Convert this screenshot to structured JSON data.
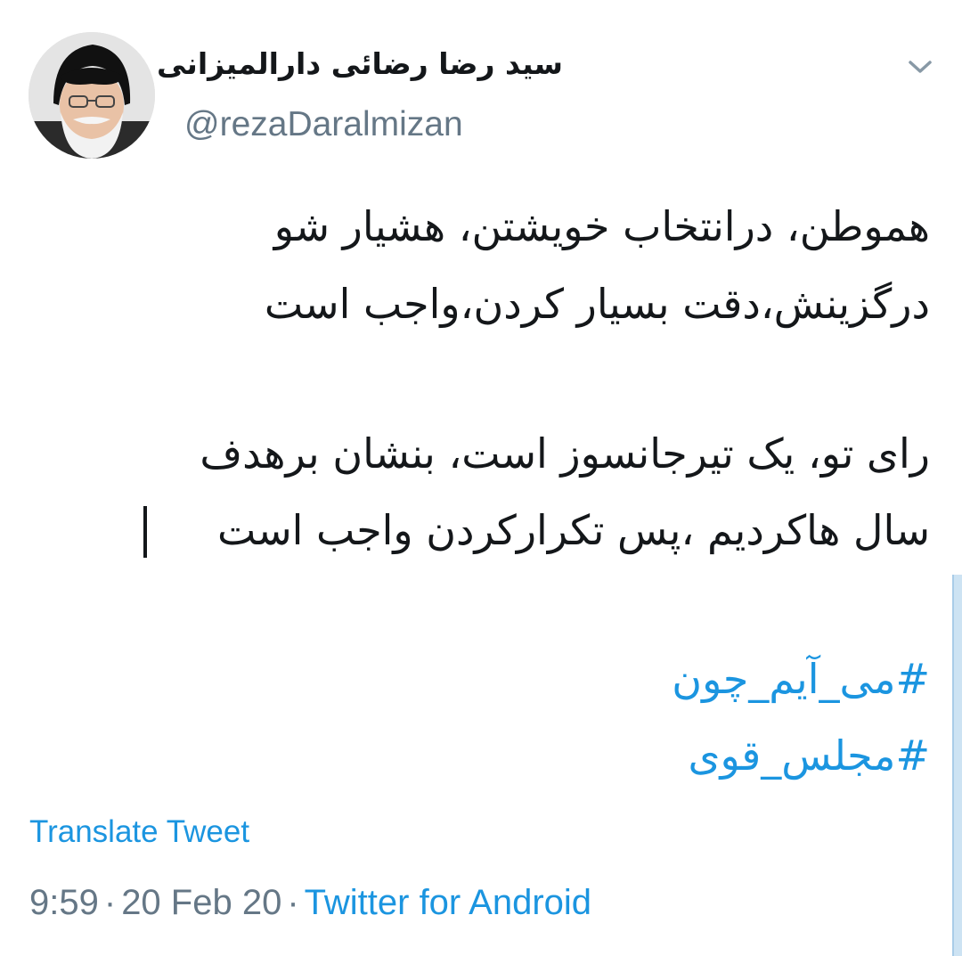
{
  "author": {
    "display_name": "سید رضا رضائی دارالمیزانی",
    "handle": "@rezaDaralmizan",
    "avatar_icon": "profile-photo"
  },
  "tweet": {
    "lines": [
      "هموطن، درانتخاب خویشتن، هشیار شو",
      "درگزینش،دقت بسیار کردن،واجب است",
      "رای تو، یک تیرجانسوز است، بنشان برهدف",
      "سال هاکردیم ،پس تکرارکردن واجب است"
    ],
    "hashtags": [
      "#می_آیم_چون",
      "#مجلس_قوی"
    ]
  },
  "actions": {
    "translate_label": "Translate Tweet",
    "menu_icon": "chevron-down-icon"
  },
  "meta": {
    "time": "9:59",
    "date": "20 Feb 20",
    "separator": "·",
    "source": "Twitter for Android"
  },
  "colors": {
    "link": "#1b95e0",
    "secondary_text": "#657786",
    "primary_text": "#14171a"
  }
}
